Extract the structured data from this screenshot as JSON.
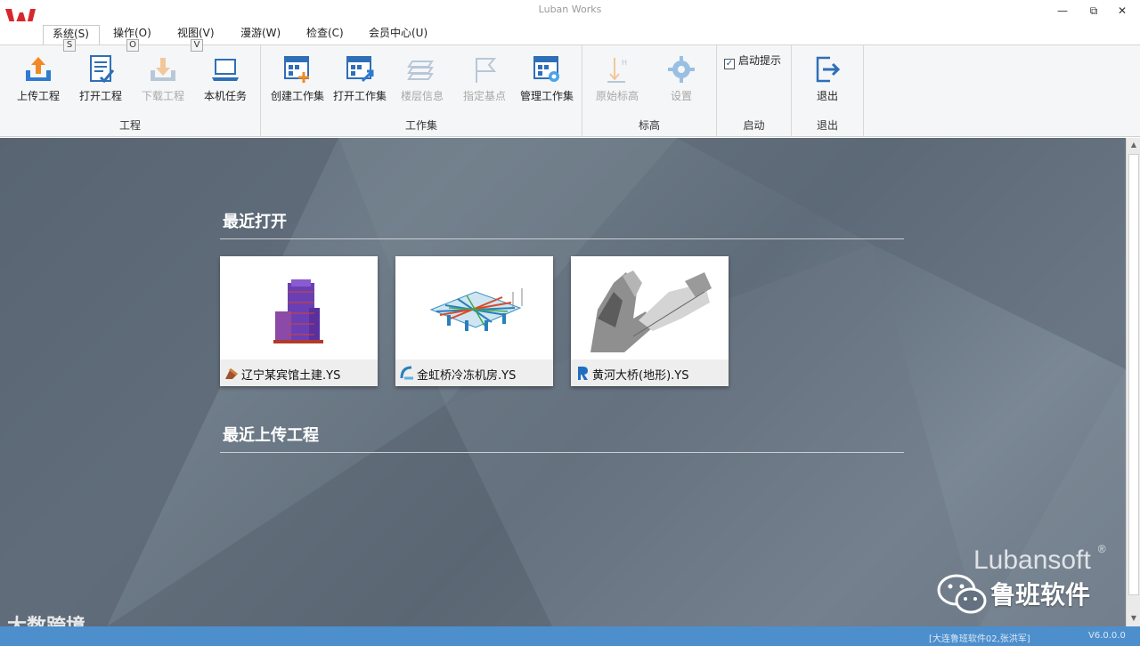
{
  "window": {
    "title": "Luban Works",
    "minimize": "—",
    "restore": "⧉",
    "close": "✕"
  },
  "menu": {
    "tabs": [
      {
        "label": "系统(S)",
        "keytip": "S"
      },
      {
        "label": "操作(O)",
        "keytip": "O"
      },
      {
        "label": "视图(V)",
        "keytip": "V"
      },
      {
        "label": "漫游(W)"
      },
      {
        "label": "检查(C)"
      },
      {
        "label": "会员中心(U)"
      }
    ]
  },
  "ribbon": {
    "groups": {
      "project": "工程",
      "workset": "工作集",
      "elevation": "标高",
      "startup": "启动",
      "exit": "退出"
    },
    "buttons": {
      "upload": "上传工程",
      "open_project": "打开工程",
      "download": "下载工程",
      "local_tasks": "本机任务",
      "create_workset": "创建工作集",
      "open_workset": "打开工作集",
      "floor_info": "楼层信息",
      "base_point": "指定基点",
      "manage_workset": "管理工作集",
      "original_elevation": "原始标高",
      "settings": "设置",
      "exit": "退出"
    },
    "startup_tip": {
      "label": "启动提示",
      "checked": true
    }
  },
  "main": {
    "recent_open_title": "最近打开",
    "recent_upload_title": "最近上传工程",
    "recent_files": [
      {
        "name": "辽宁某宾馆土建.YS",
        "type": "civil"
      },
      {
        "name": "金虹桥冷冻机房.YS",
        "type": "mep"
      },
      {
        "name": "黄河大桥(地形).YS",
        "type": "revit"
      }
    ],
    "brand": "Lubansoft",
    "brand_mark": "®",
    "wechat_label": "鲁班软件",
    "watermark": "大数跨境"
  },
  "status": {
    "user": "[大连鲁班软件02,张洪军]",
    "version": "V6.0.0.0"
  },
  "colors": {
    "ribbon_bg": "#f5f6f7",
    "main_bg": "#647180",
    "status_bg": "#4d8fcc",
    "accent_blue": "#2e7bd1"
  }
}
